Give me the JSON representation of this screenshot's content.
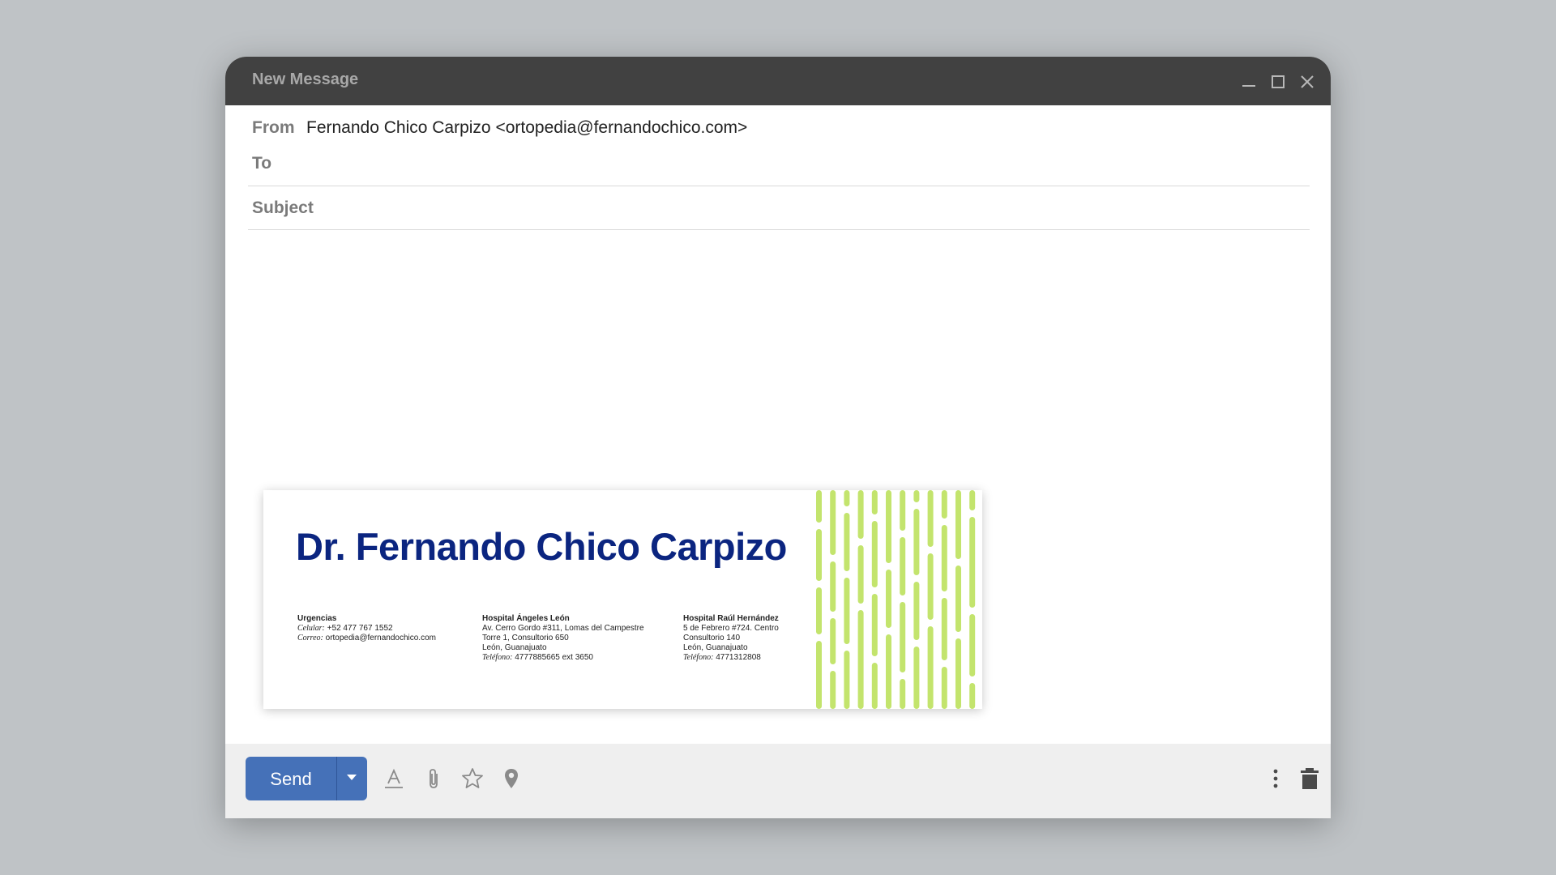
{
  "window": {
    "title": "New Message"
  },
  "fields": {
    "from_label": "From",
    "from_value": "Fernando Chico Carpizo <ortopedia@fernandochico.com>",
    "to_label": "To",
    "to_value": "",
    "subject_label": "Subject",
    "subject_value": ""
  },
  "signature": {
    "name": "Dr. Fernando Chico Carpizo",
    "col1": {
      "heading": "Urgencias",
      "line1_label": "Celular:",
      "line1_value": " +52 477 767 1552",
      "line2_label": "Correo:",
      "line2_value": " ortopedia@fernandochico.com"
    },
    "col2": {
      "heading": "Hospital Ángeles León",
      "line1": "Av. Cerro Gordo #311, Lomas del Campestre",
      "line2": "Torre 1, Consultorio 650",
      "line3": "León, Guanajuato",
      "phone_label": "Teléfono:",
      "phone_value": " 4777885665 ext 3650"
    },
    "col3": {
      "heading": "Hospital Raúl Hernández",
      "line1": "5 de Febrero #724. Centro",
      "line2": "Consultorio 140",
      "line3": "León, Guanajuato",
      "phone_label": "Teléfono:",
      "phone_value": " 4771312808"
    },
    "colors": {
      "name": "#0b2580",
      "stripes": "#c3e46d"
    }
  },
  "footer": {
    "send_label": "Send",
    "icons": [
      "format-text-icon",
      "attach-icon",
      "star-icon",
      "location-icon",
      "more-vert-icon",
      "trash-icon"
    ]
  },
  "colors": {
    "titlebar": "#414141",
    "send": "#4571b8",
    "footer": "#efefef",
    "background": "#bfc3c6"
  }
}
